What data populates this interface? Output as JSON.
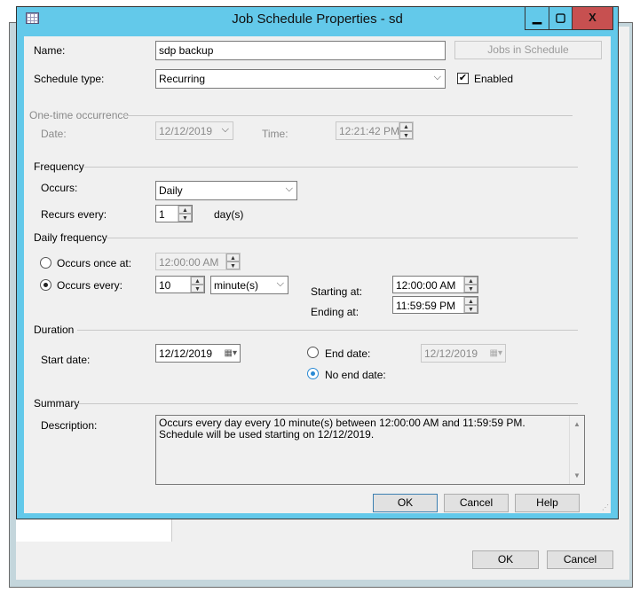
{
  "parent": {
    "ok": "OK",
    "cancel": "Cancel"
  },
  "dialog": {
    "title": "Job Schedule Properties - sd",
    "controls": {
      "minimize": "▁",
      "maximize": "▢",
      "close": "X"
    },
    "name_label": "Name:",
    "name_value": "sdp backup",
    "jobs_button": "Jobs in Schedule",
    "schedule_type_label": "Schedule type:",
    "schedule_type_value": "Recurring",
    "enabled_label": "Enabled",
    "enabled": true,
    "one_time": {
      "header": "One-time occurrence",
      "date_label": "Date:",
      "date_value": "12/12/2019",
      "time_label": "Time:",
      "time_value": "12:21:42 PM"
    },
    "frequency": {
      "header": "Frequency",
      "occurs_label": "Occurs:",
      "occurs_value": "Daily",
      "recurs_label": "Recurs every:",
      "recurs_value": "1",
      "recurs_unit": "day(s)"
    },
    "daily": {
      "header": "Daily frequency",
      "once_label": "Occurs once at:",
      "once_value": "12:00:00 AM",
      "every_label": "Occurs every:",
      "every_value": "10",
      "every_unit": "minute(s)",
      "starting_label": "Starting at:",
      "starting_value": "12:00:00 AM",
      "ending_label": "Ending at:",
      "ending_value": "11:59:59 PM",
      "selected": "every"
    },
    "duration": {
      "header": "Duration",
      "start_label": "Start date:",
      "start_value": "12/12/2019",
      "end_label": "End date:",
      "end_value": "12/12/2019",
      "noend_label": "No end date:",
      "selected": "no_end"
    },
    "summary": {
      "header": "Summary",
      "desc_label": "Description:",
      "desc_value": "Occurs every day every 10 minute(s) between 12:00:00 AM and 11:59:59 PM. Schedule will be used starting on 12/12/2019."
    },
    "buttons": {
      "ok": "OK",
      "cancel": "Cancel",
      "help": "Help"
    }
  }
}
